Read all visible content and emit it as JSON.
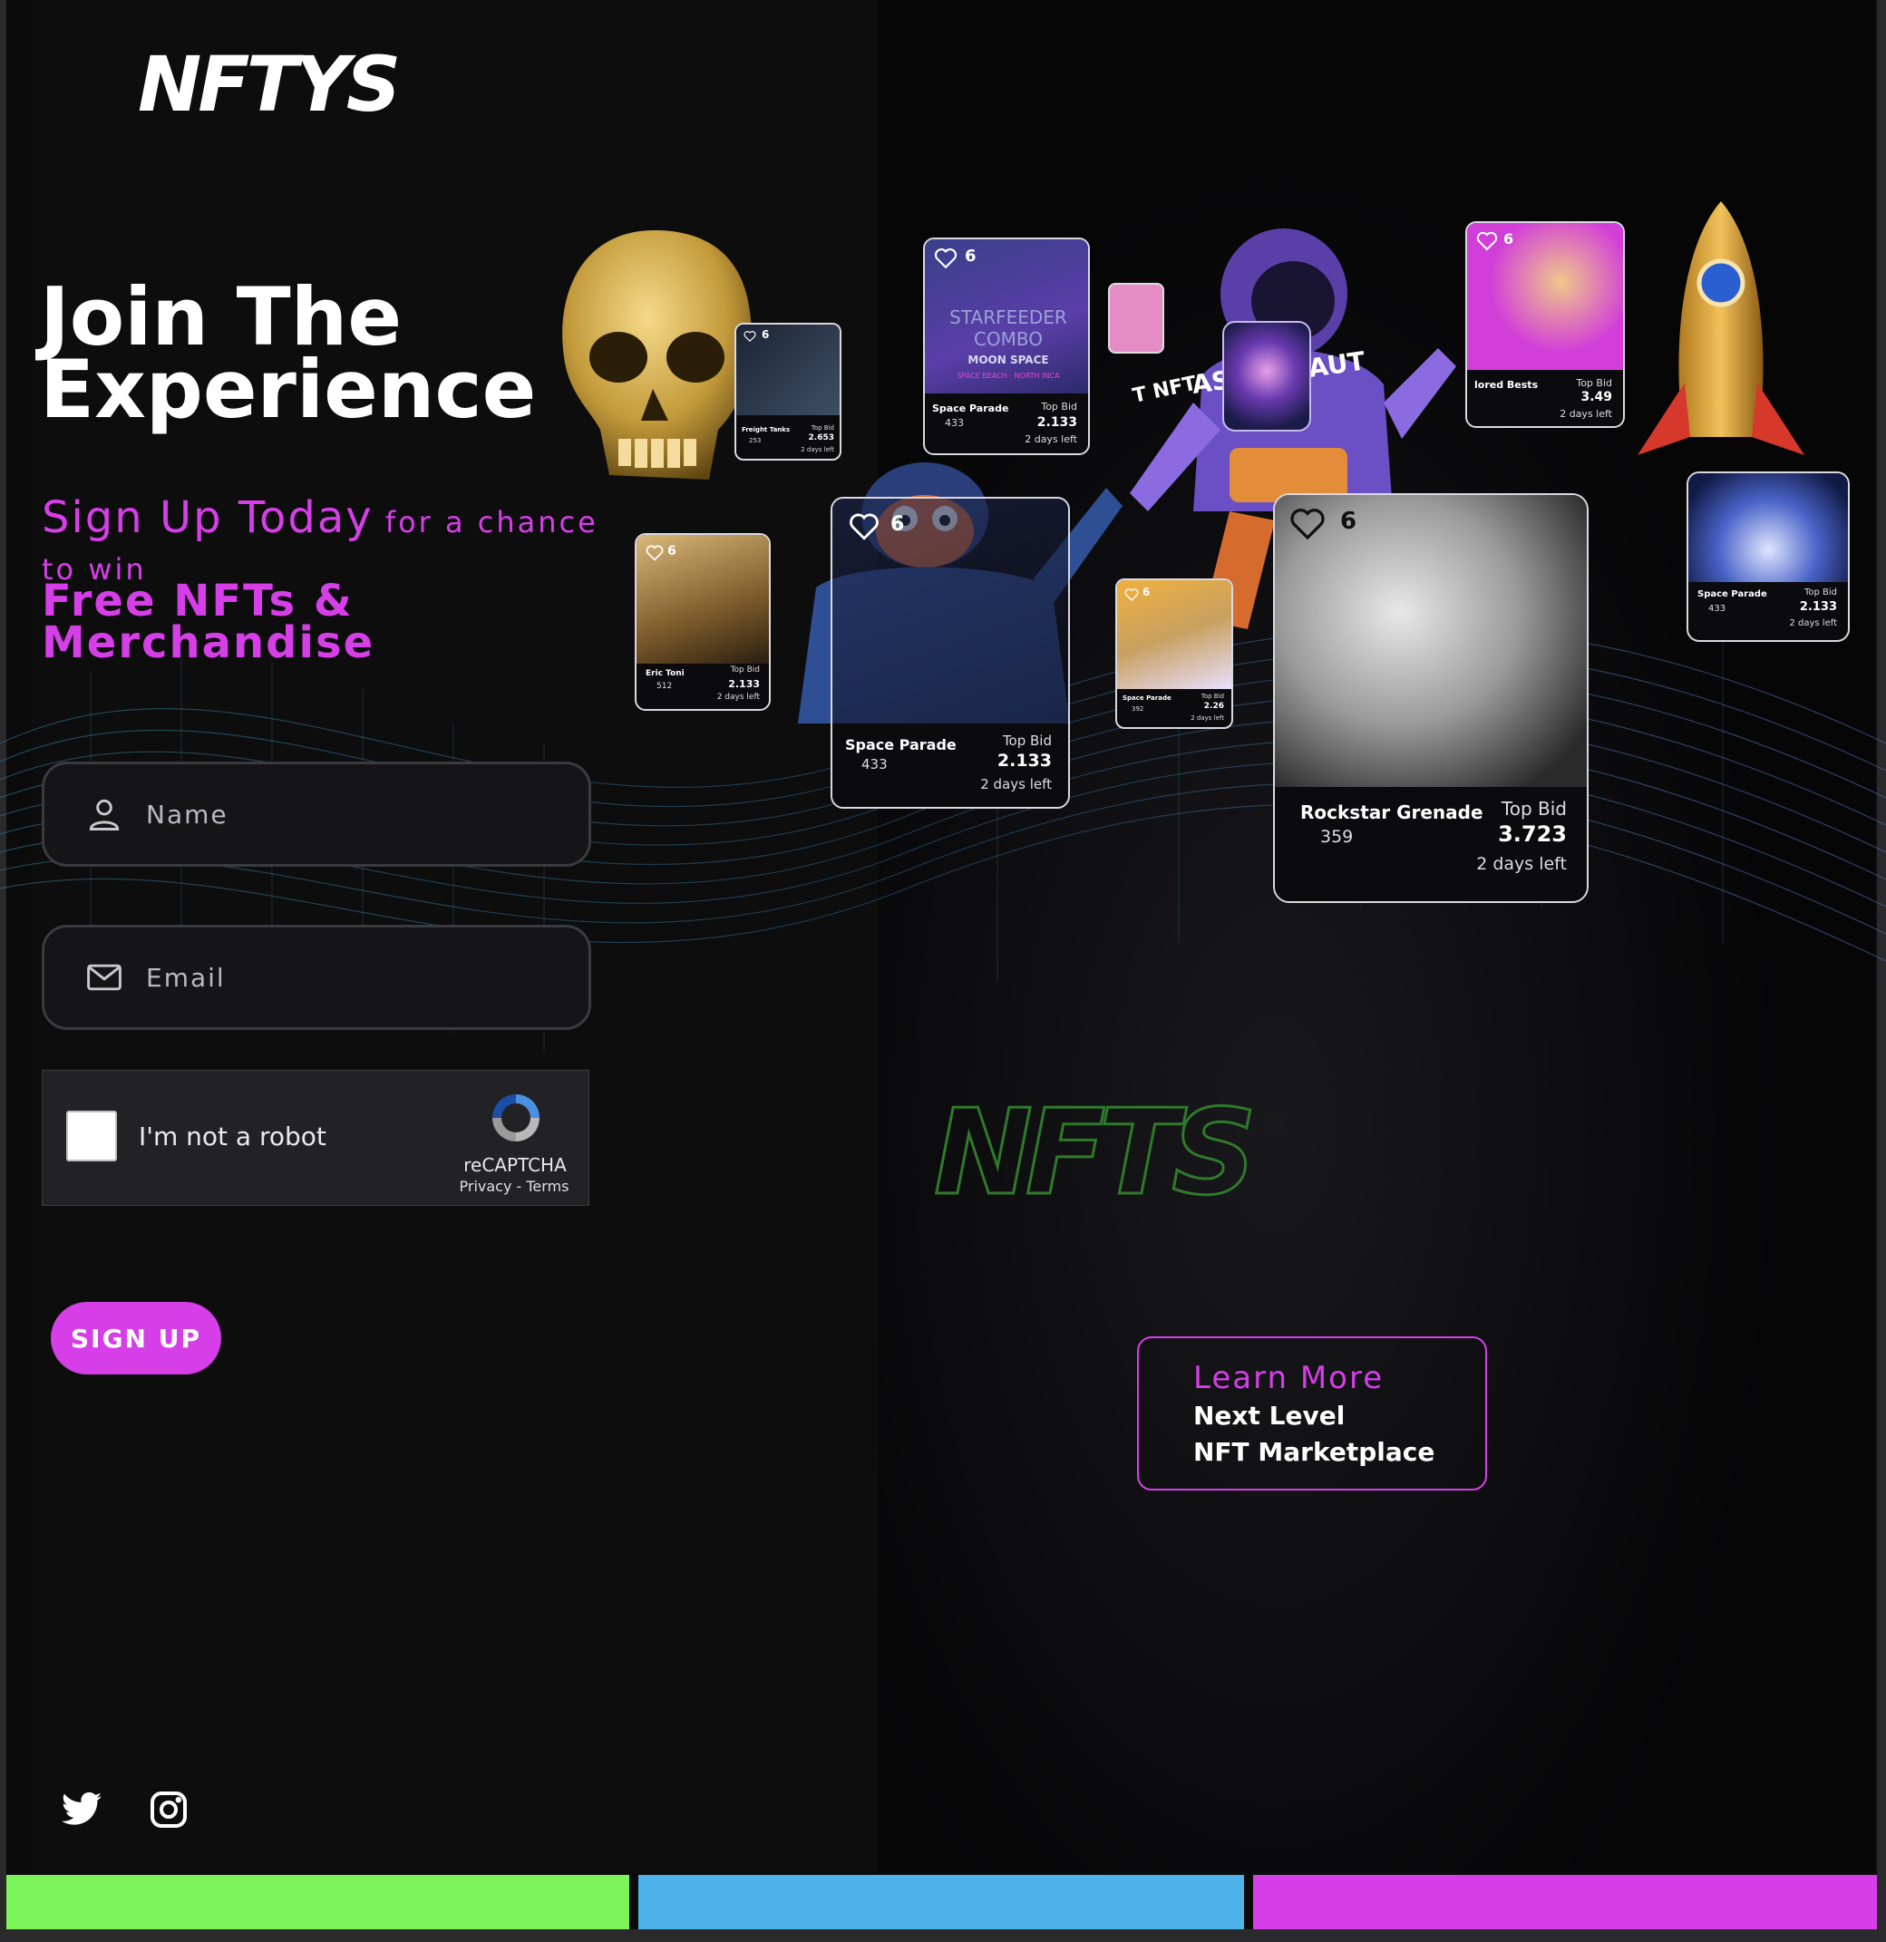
{
  "brand": {
    "logo_text": "NFTYS"
  },
  "hero": {
    "headline_line1": "Join The",
    "headline_line2": "Experience",
    "sub_big": "Sign Up Today",
    "sub_small": " for a chance to win",
    "prize_line1": "Free NFTs &",
    "prize_line2": "Merchandise"
  },
  "form": {
    "name_placeholder": "Name",
    "email_placeholder": "Email",
    "captcha_label": "I'm not a robot",
    "captcha_brand": "reCAPTCHA",
    "captcha_links": "Privacy - Terms",
    "submit_label": "SIGN UP"
  },
  "learn_more": {
    "title": "Learn More",
    "line1": "Next Level",
    "line2": "NFT Marketplace"
  },
  "graffiti_text": "NFTS",
  "astronaut_text": "ASTRONAUT",
  "astronaut_prefix": "T NFT",
  "cards": [
    {
      "name": "Freight Tanks",
      "likes": "253",
      "top_bid_label": "Top Bid",
      "value": "2.653",
      "days": "2 days left",
      "favs": "6"
    },
    {
      "name": "Space Parade",
      "likes": "433",
      "top_bid_label": "Top Bid",
      "value": "2.133",
      "days": "2 days left",
      "favs": "6",
      "art_title": "STARFEEDER COMBO",
      "art_sub": "MOON SPACE",
      "art_sub2": "SPACE BEACH · NORTH INCA"
    },
    {
      "name": "lored Bests",
      "likes": "",
      "top_bid_label": "Top Bid",
      "value": "3.49",
      "days": "2 days left",
      "favs": "6"
    },
    {
      "name": "Eric Toni",
      "likes": "512",
      "top_bid_label": "Top Bid",
      "value": "2.133",
      "days": "2 days left",
      "favs": "6"
    },
    {
      "name": "Space Parade",
      "likes": "433",
      "top_bid_label": "Top Bid",
      "value": "2.133",
      "days": "2 days left",
      "favs": "6"
    },
    {
      "name": "Space Parade",
      "likes": "392",
      "top_bid_label": "Top Bid",
      "value": "2.26",
      "days": "2 days left",
      "favs": "6"
    },
    {
      "name": "Rockstar Grenade",
      "likes": "359",
      "top_bid_label": "Top Bid",
      "value": "3.723",
      "days": "2 days left",
      "favs": "6"
    },
    {
      "name": "Space Parade",
      "likes": "433",
      "top_bid_label": "Top Bid",
      "value": "2.133",
      "days": "2 days left",
      "favs": ""
    }
  ],
  "social": [
    "twitter-icon",
    "instagram-icon"
  ],
  "colors": {
    "accent": "#d63ee8",
    "green": "#7df45a",
    "blue": "#4db3ea",
    "magenta": "#d63ee8"
  }
}
